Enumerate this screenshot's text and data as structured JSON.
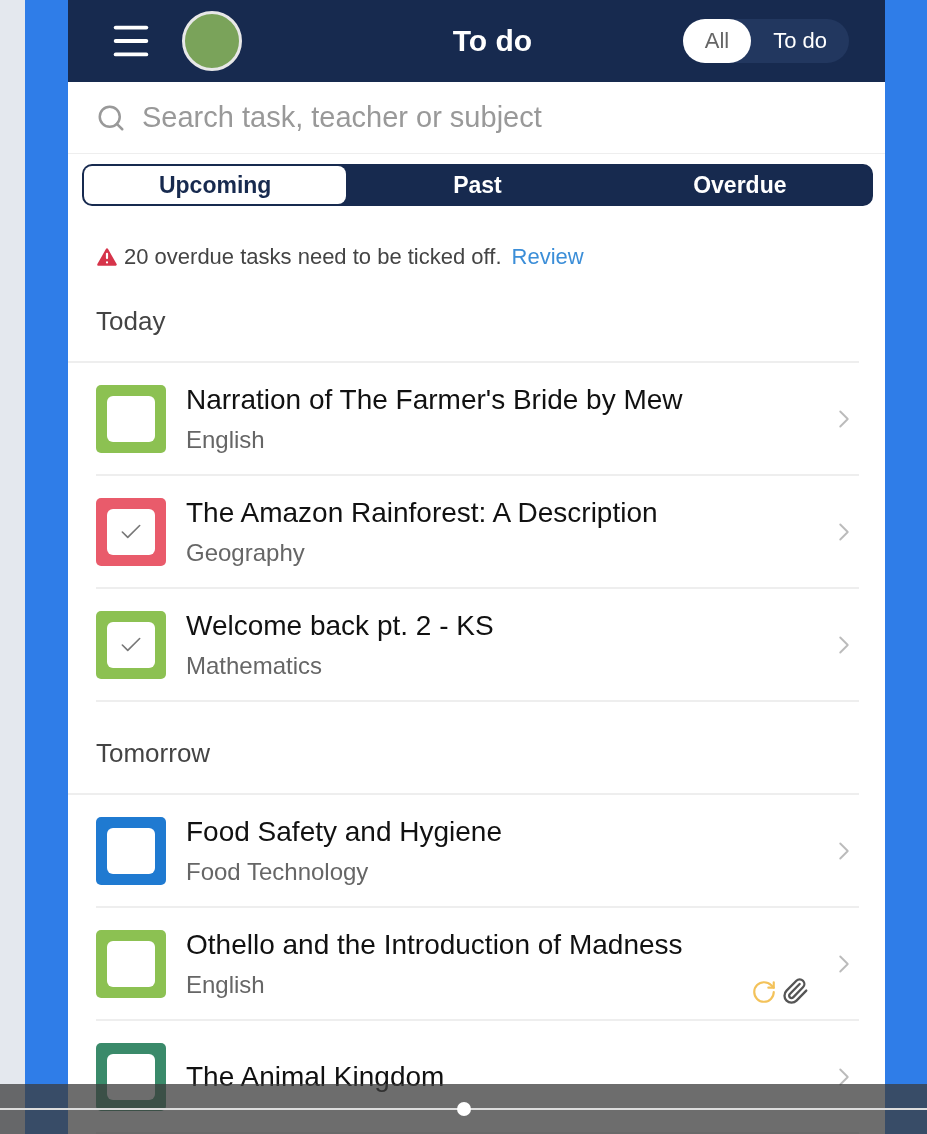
{
  "header": {
    "title": "To do",
    "filter": [
      {
        "label": "All",
        "selected": true
      },
      {
        "label": "To do",
        "selected": false
      }
    ]
  },
  "search": {
    "placeholder": "Search task, teacher or subject"
  },
  "tabs": [
    {
      "label": "Upcoming",
      "selected": true
    },
    {
      "label": "Past",
      "selected": false
    },
    {
      "label": "Overdue",
      "selected": false
    }
  ],
  "notice": {
    "text": "20 overdue tasks need to be ticked off.",
    "link": "Review"
  },
  "sections": [
    {
      "title": "Today",
      "tasks": [
        {
          "title": "Narration of The Farmer's Bride by Mew",
          "subject": "English",
          "color": "#8cc152",
          "checked": false,
          "attachments": false
        },
        {
          "title": "The Amazon Rainforest: A Description",
          "subject": "Geography",
          "color": "#e95b6b",
          "checked": true,
          "attachments": false
        },
        {
          "title": "Welcome back pt. 2 - KS",
          "subject": "Mathematics",
          "color": "#8cc152",
          "checked": true,
          "attachments": false
        }
      ]
    },
    {
      "title": "Tomorrow",
      "tasks": [
        {
          "title": "Food Safety and Hygiene",
          "subject": "Food Technology",
          "color": "#1f7ad1",
          "checked": false,
          "attachments": false
        },
        {
          "title": "Othello and the Introduction of Madness",
          "subject": "English",
          "color": "#8cc152",
          "checked": false,
          "attachments": true
        },
        {
          "title": "The Animal Kingdom",
          "color": "#3a8a6a",
          "checked": false,
          "attachments": false
        }
      ]
    }
  ],
  "player": {
    "level": 0.5
  }
}
